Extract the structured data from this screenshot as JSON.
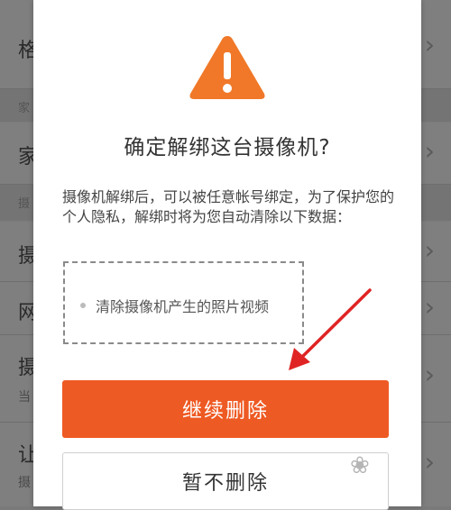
{
  "background": {
    "rows": [
      {
        "title": "格",
        "sub": ""
      },
      {
        "title": "家",
        "sub": ""
      },
      {
        "title": "摄",
        "sub": ""
      },
      {
        "title": "网",
        "sub": ""
      },
      {
        "title": "摄",
        "sub": "当"
      },
      {
        "title": "让",
        "sub": "摄"
      }
    ],
    "sections": [
      "家",
      "摄"
    ],
    "chevron": "›"
  },
  "dialog": {
    "icon": "warning-triangle-icon",
    "title": "确定解绑这台摄像机?",
    "message": "摄像机解绑后，可以被任意帐号绑定，为了保护您的个人隐私，解绑时将为您自动清除以下数据：",
    "items": [
      "清除摄像机产生的照片视频"
    ],
    "primary_button": "继续删除",
    "secondary_button": "暂不删除"
  },
  "colors": {
    "accent": "#ee5a23",
    "warning": "#f07828",
    "annotation_arrow": "#e02424"
  }
}
